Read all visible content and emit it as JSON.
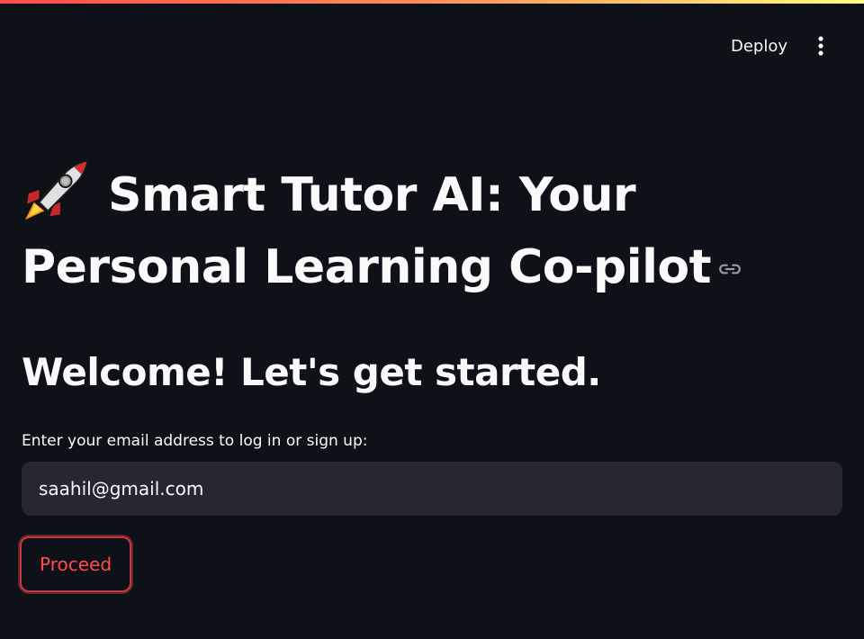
{
  "header": {
    "deploy_label": "Deploy",
    "menu_icon": "vertical-ellipsis-icon"
  },
  "main": {
    "title": "Smart Tutor AI: Your Personal Learning Co-pilot",
    "title_icon": "rocket-icon",
    "subtitle": "Welcome! Let's get started.",
    "email_label": "Enter your email address to log in or sign up:",
    "email_value": "saahil@gmail.com",
    "proceed_label": "Proceed"
  },
  "colors": {
    "background": "#0e1117",
    "input_background": "#262730",
    "accent": "#ff4b4b",
    "text": "#fafafa"
  }
}
